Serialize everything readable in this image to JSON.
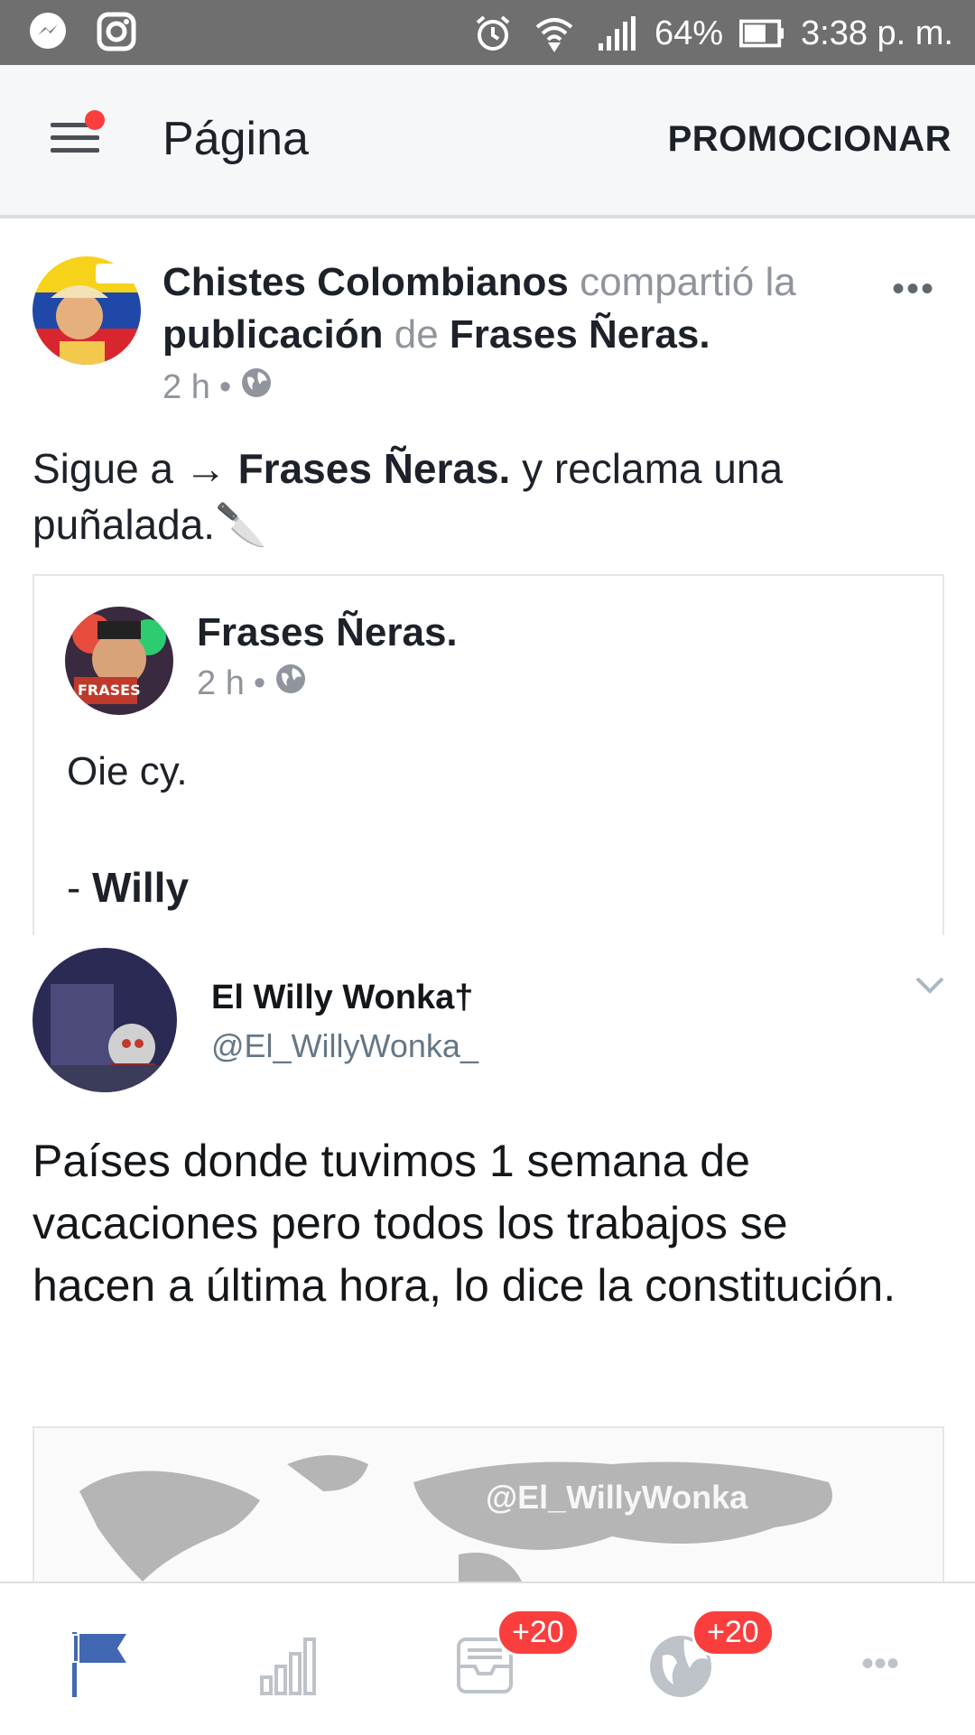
{
  "status_bar": {
    "battery": "64%",
    "time": "3:38 p. m.",
    "icons": [
      "messenger-icon",
      "instagram-icon",
      "alarm-icon",
      "wifi-icon",
      "signal-icon",
      "battery-icon"
    ]
  },
  "header": {
    "title": "Página",
    "promote_label": "PROMOCIONAR"
  },
  "post": {
    "author": "Chistes Colombianos",
    "action": "compartió la",
    "object": "publicación",
    "prep": "de",
    "source": "Frases Ñeras.",
    "time": "2 h",
    "dot": "•",
    "more": "•••",
    "text_prefix": "Sigue a → ",
    "text_bold": "Frases Ñeras.",
    "text_suffix": " y reclama una puñalada.",
    "emoji": "🔪"
  },
  "shared": {
    "name": "Frases Ñeras.",
    "time": "2 h",
    "dot": "•",
    "line1": "Oie cy.",
    "line2_prefix": "- ",
    "line2_bold": "Willy"
  },
  "tweet": {
    "name": "El Willy Wonka†",
    "handle": "@El_WillyWonka_",
    "text": "Países donde tuvimos 1 semana de vacaciones pero todos los trabajos se hacen a última hora, lo dice la constitución.",
    "watermark": "@El_WillyWonka"
  },
  "bottom_nav": {
    "items": [
      {
        "name": "pages-flag-icon"
      },
      {
        "name": "insights-icon"
      },
      {
        "name": "inbox-icon",
        "badge": "+20"
      },
      {
        "name": "notifications-globe-icon",
        "badge": "+20"
      },
      {
        "name": "more-icon",
        "label": "•••"
      }
    ]
  },
  "colors": {
    "status_bar": "#6f6f6f",
    "header_bg": "#f6f7f9",
    "active_blue": "#4267b2",
    "badge_red": "#fa3e3e"
  }
}
